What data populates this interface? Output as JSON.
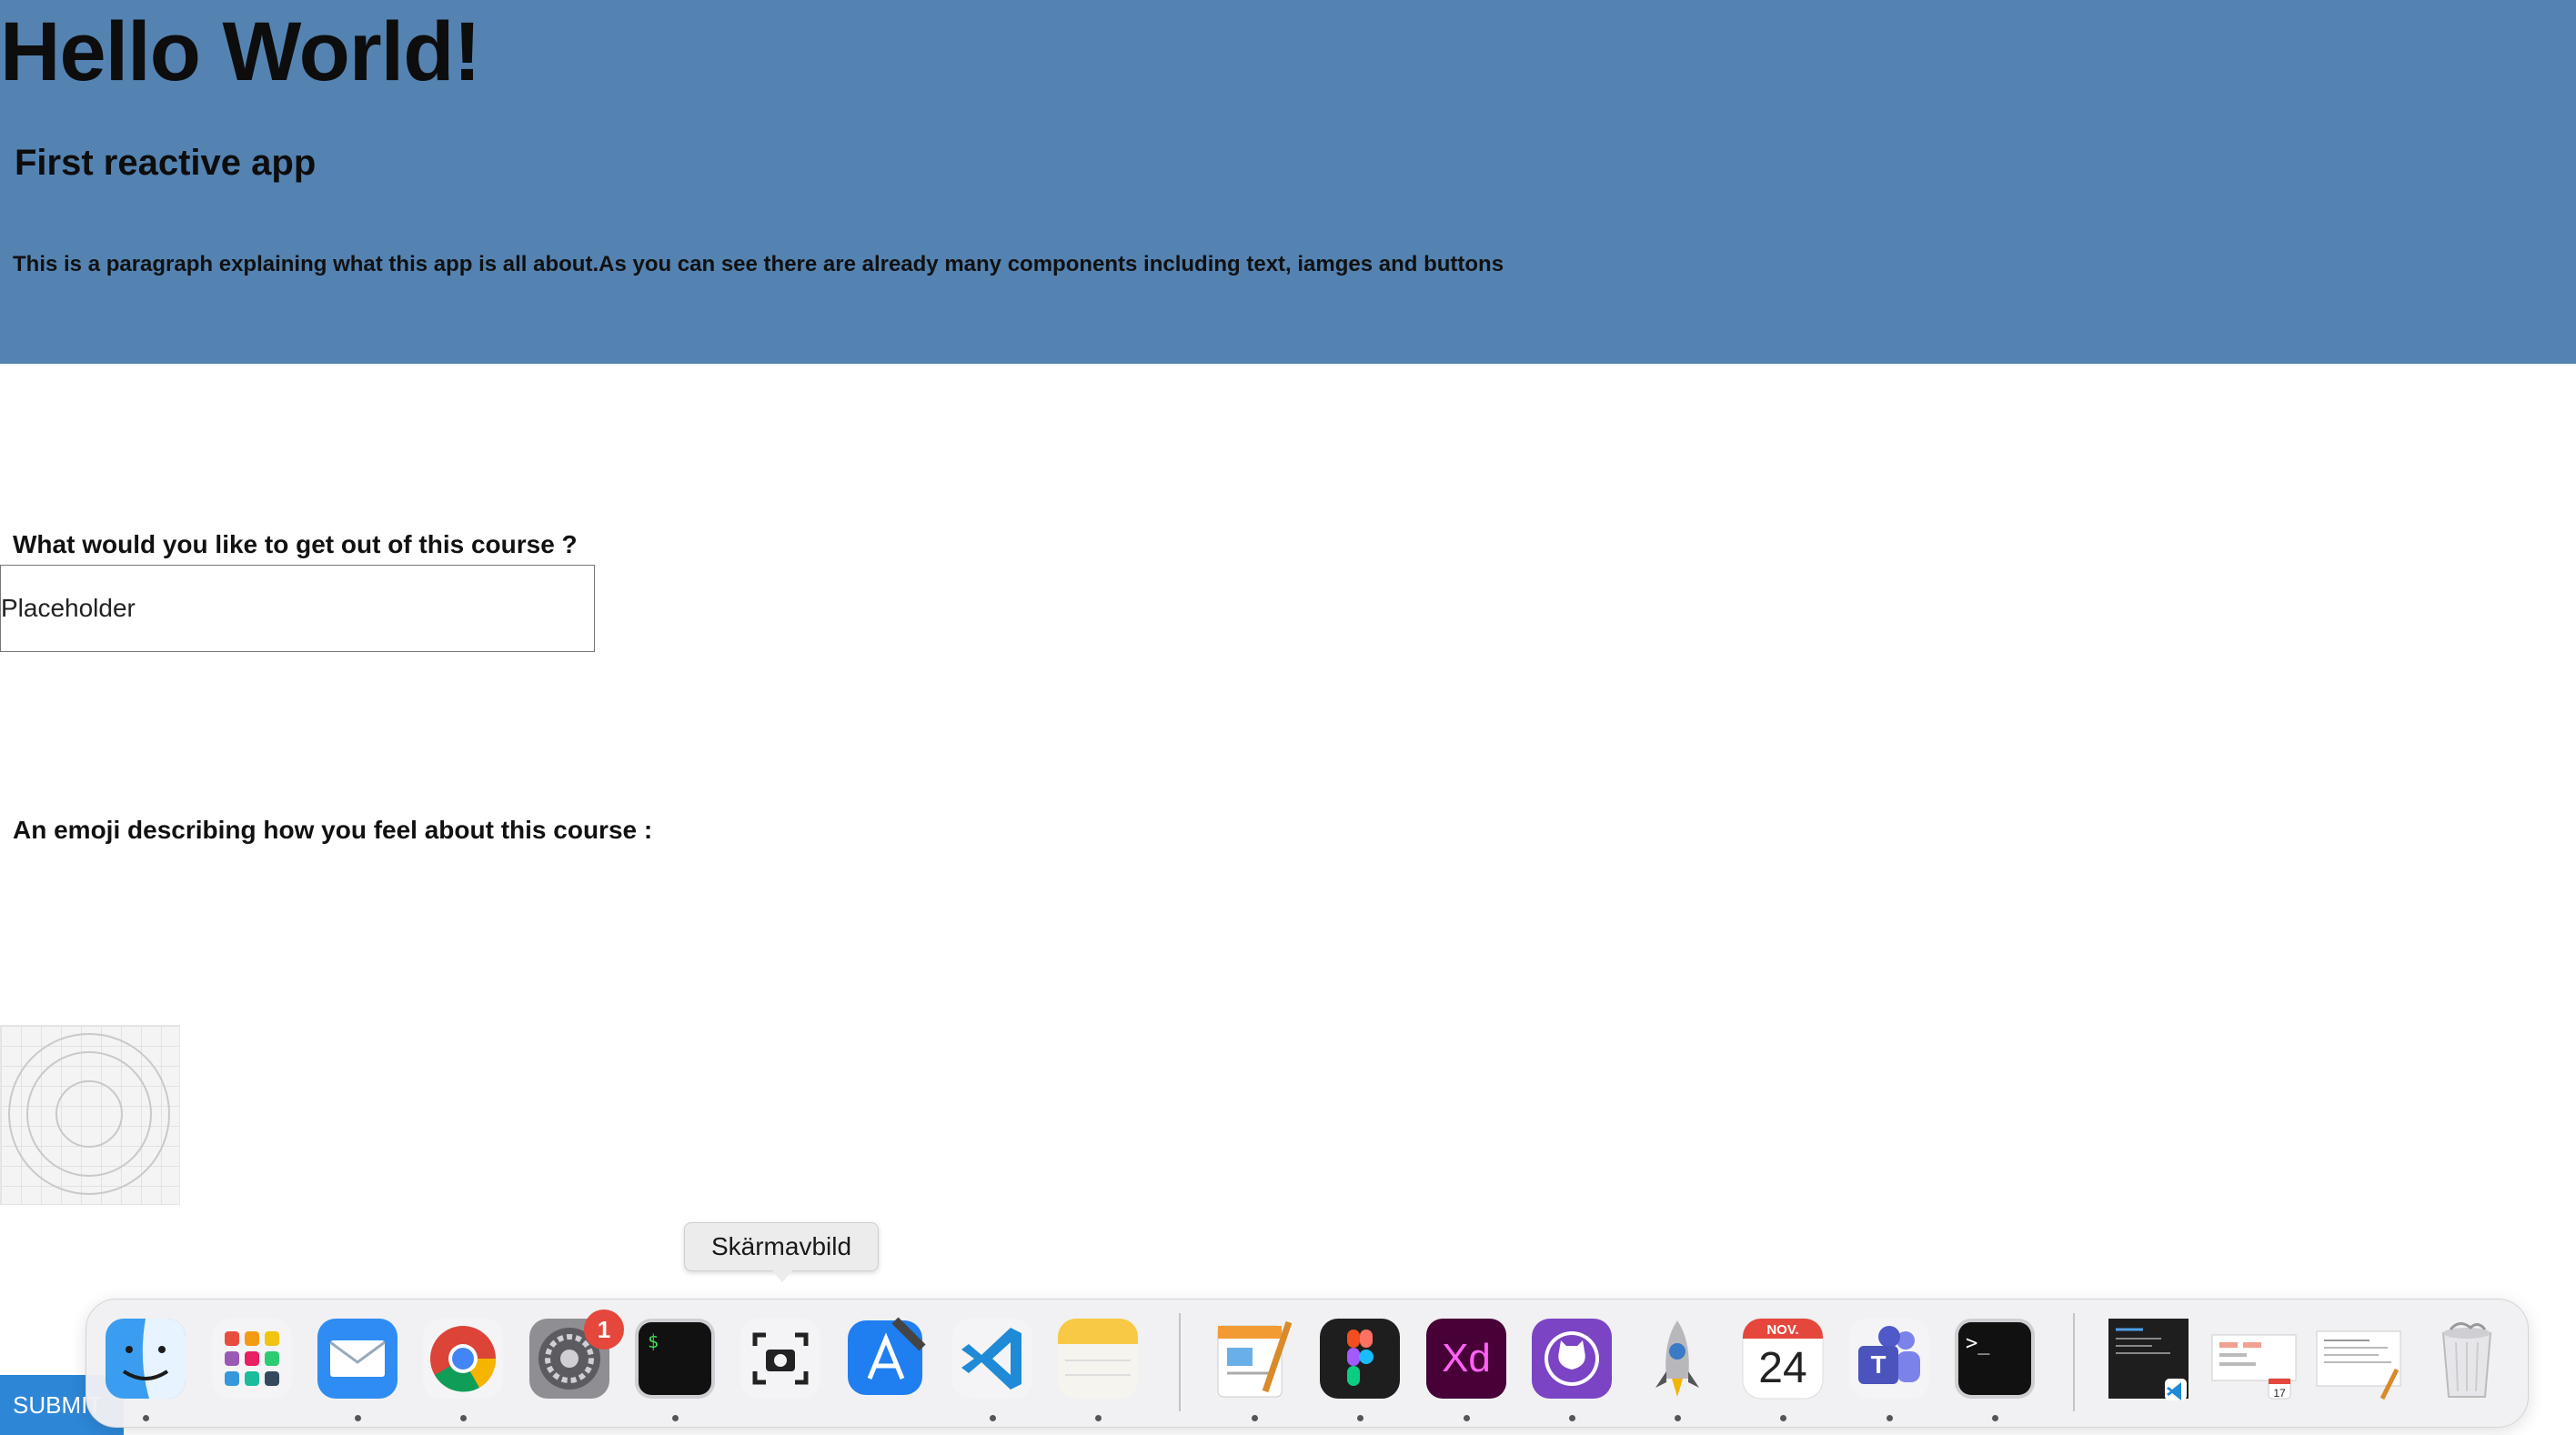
{
  "header": {
    "title": "Hello World!",
    "subtitle": "First reactive app",
    "paragraph": "This is a paragraph explaining what this app is all about.As you can see there are already many components including text, iamges and buttons"
  },
  "form": {
    "question_label": "What would you like to get out of this course ?",
    "input_value": "Placeholder",
    "emoji_label": "An emoji describing how you feel about this course :",
    "submit_label": "SUBMIT"
  },
  "dock": {
    "tooltip": "Skärmavbild",
    "apps": [
      {
        "name": "Finder",
        "icon": "finder-icon"
      },
      {
        "name": "Launchpad",
        "icon": "launchpad-icon"
      },
      {
        "name": "Mail",
        "icon": "mail-icon"
      },
      {
        "name": "Chrome",
        "icon": "chrome-icon"
      },
      {
        "name": "System Settings",
        "icon": "settings-icon",
        "badge": "1"
      },
      {
        "name": "Terminal",
        "icon": "terminal-icon"
      },
      {
        "name": "Skärmavbild",
        "icon": "screenshot-icon"
      },
      {
        "name": "Xcode",
        "icon": "xcode-icon"
      },
      {
        "name": "Visual Studio Code",
        "icon": "vscode-icon"
      },
      {
        "name": "Notes",
        "icon": "notes-icon"
      },
      {
        "name": "Pages",
        "icon": "pages-icon"
      },
      {
        "name": "Figma",
        "icon": "figma-icon"
      },
      {
        "name": "Adobe XD",
        "icon": "xd-icon"
      },
      {
        "name": "GitHub Desktop",
        "icon": "github-icon"
      },
      {
        "name": "Rocket",
        "icon": "rocket-icon"
      },
      {
        "name": "Calendar",
        "icon": "calendar-icon"
      },
      {
        "name": "Teams",
        "icon": "teams-icon"
      },
      {
        "name": "Terminal",
        "icon": "terminal-icon"
      }
    ],
    "calendar_month": "NOV.",
    "calendar_day": "24",
    "settings_badge": "1",
    "xd_label": "Xd",
    "preview_calendar_day": "17",
    "colors": {
      "header_bg": "#5483b2",
      "submit_bg": "#2d86d6",
      "badge": "#e5473c"
    }
  }
}
